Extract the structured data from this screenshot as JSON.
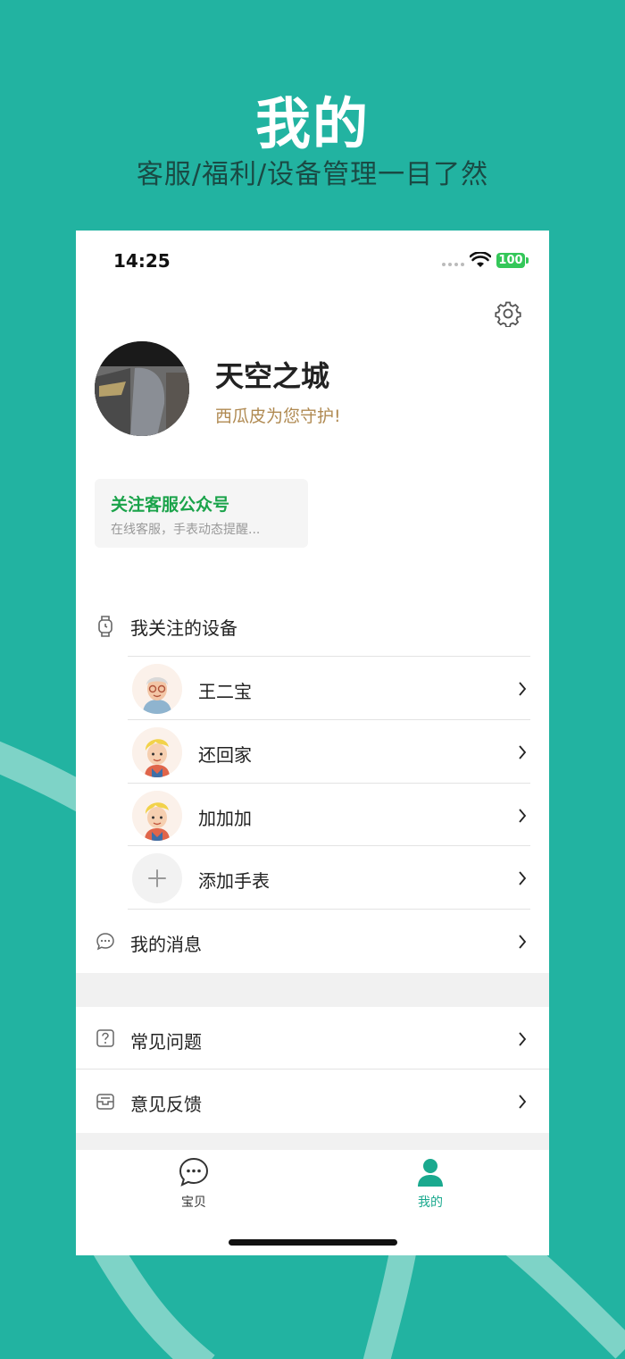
{
  "promo": {
    "title": "我的",
    "subtitle": "客服/福利/设备管理一目了然"
  },
  "status_bar": {
    "time": "14:25",
    "battery": "100"
  },
  "profile": {
    "nickname": "天空之城",
    "tagline": "西瓜皮为您守护!"
  },
  "follow_card": {
    "title": "关注客服公众号",
    "description": "在线客服，手表动态提醒..."
  },
  "devices_section": {
    "label": "我关注的设备",
    "devices": [
      {
        "name": "王二宝",
        "avatar": "grandpa-avatar"
      },
      {
        "name": "还回家",
        "avatar": "boy-avatar"
      },
      {
        "name": "加加加",
        "avatar": "boy-avatar"
      }
    ],
    "add_label": "添加手表"
  },
  "menu": {
    "messages": "我的消息",
    "faq": "常见问题",
    "feedback": "意见反馈"
  },
  "tabbar": {
    "tabs": [
      {
        "label": "宝贝",
        "icon": "chat-bubble-icon",
        "active": false
      },
      {
        "label": "我的",
        "icon": "person-icon",
        "active": true
      }
    ]
  },
  "colors": {
    "background": "#22b3a1",
    "accent_green": "#1aa34a",
    "active_tab": "#1aa98e",
    "tagline_gold": "#b08a52"
  }
}
